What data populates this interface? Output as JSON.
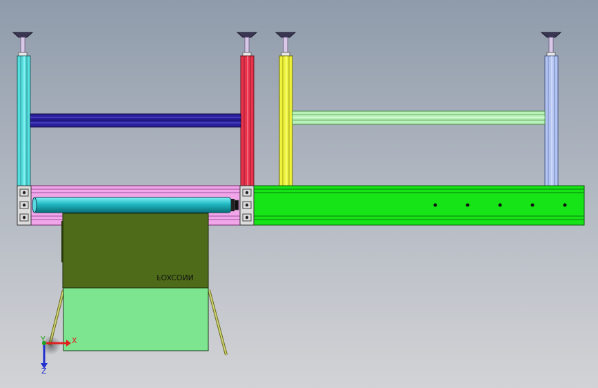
{
  "viewport": {
    "background_top": "#8f9bab",
    "background_bottom": "#d2d3d6"
  },
  "model": {
    "label_text": "FOXCONN",
    "label_mirrored": true,
    "colors": {
      "leg_cyan": "#55dede",
      "leg_red": "#e8334d",
      "leg_yellow": "#eef23a",
      "leg_lightblue": "#b4c4f2",
      "beam_navy": "#2a1f9a",
      "beam_mint": "#b8f2b8",
      "frame_pink": "#f0a6e8",
      "roller_teal": "#1fb8c2",
      "rail_green": "#16e416",
      "panel_olive": "#4e6b1a",
      "panel_lightgreen": "#7de48f",
      "support_rod": "#b2b85a"
    }
  },
  "triad": {
    "x_label": "X",
    "y_label": "Y",
    "z_label": "Z",
    "x_color": "#e02020",
    "y_color": "#20a020",
    "z_color": "#2030d0"
  }
}
